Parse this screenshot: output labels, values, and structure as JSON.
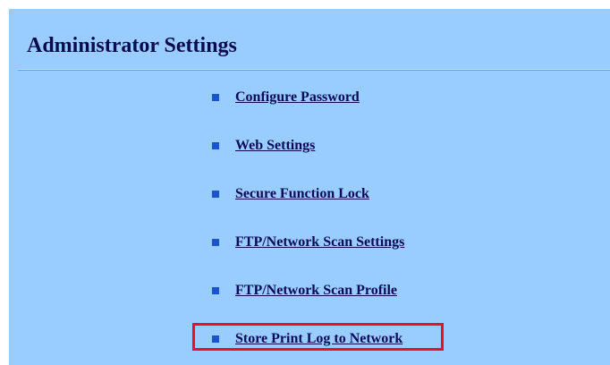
{
  "header": {
    "title": "Administrator Settings"
  },
  "menu": {
    "items": [
      {
        "label": "Configure Password"
      },
      {
        "label": "Web Settings"
      },
      {
        "label": "Secure Function Lock"
      },
      {
        "label": "FTP/Network Scan Settings"
      },
      {
        "label": "FTP/Network Scan Profile"
      },
      {
        "label": "Store Print Log to Network"
      }
    ],
    "highlighted_item": "Store Print Log to Network"
  },
  "colors": {
    "background": "#99ccff",
    "title_text": "#0a0a50",
    "link_text": "#0a0a5a",
    "bullet": "#1a55c9",
    "highlight_border": "#e8141a"
  }
}
